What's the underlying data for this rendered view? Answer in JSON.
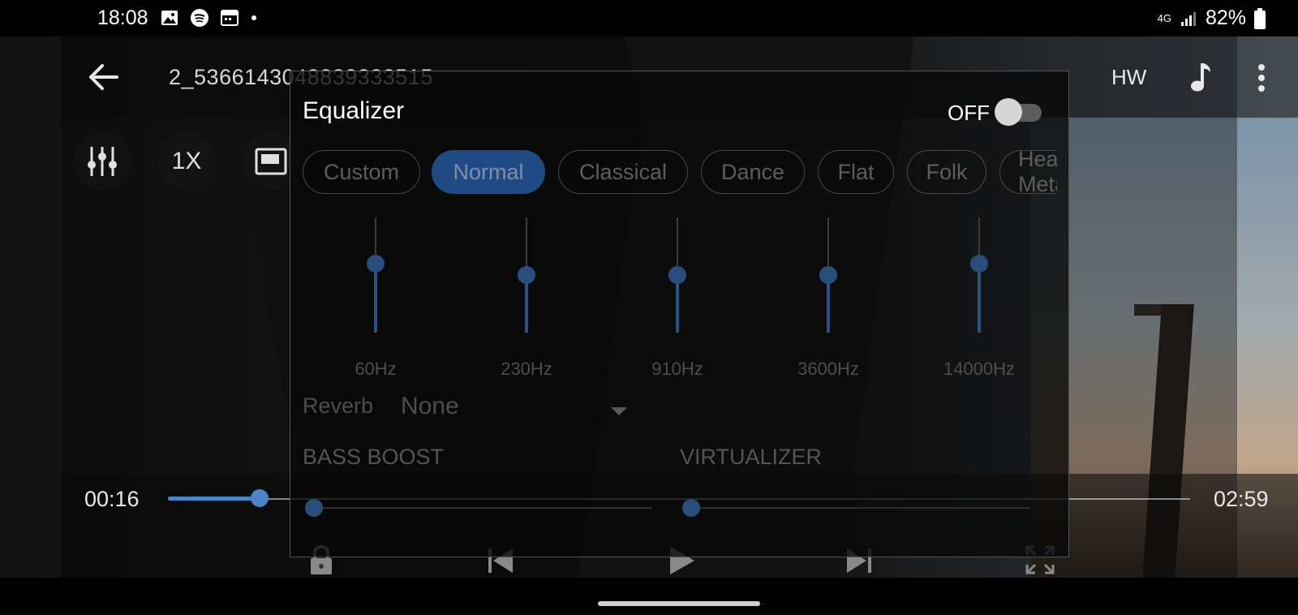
{
  "status_bar": {
    "time": "18:08",
    "network": "4G",
    "battery": "82%",
    "left_icons": [
      "gallery-icon",
      "spotify-icon",
      "calendar-icon",
      "dot-icon"
    ],
    "right_icons": [
      "signal-icon",
      "battery-icon"
    ]
  },
  "player": {
    "filename": "2_5366143048839333515",
    "hw_label": "HW",
    "speed_label": "1X",
    "current_time": "00:16",
    "total_time": "02:59",
    "progress": 0.09
  },
  "equalizer": {
    "title": "Equalizer",
    "toggle_label": "OFF",
    "enabled": false,
    "presets": [
      "Custom",
      "Normal",
      "Classical",
      "Dance",
      "Flat",
      "Folk",
      "Heavy Metal"
    ],
    "selected_preset": "Normal",
    "bands": [
      {
        "label": "60Hz",
        "level": 0.6
      },
      {
        "label": "230Hz",
        "level": 0.5
      },
      {
        "label": "910Hz",
        "level": 0.5
      },
      {
        "label": "3600Hz",
        "level": 0.5
      },
      {
        "label": "14000Hz",
        "level": 0.6
      }
    ],
    "reverb_label": "Reverb",
    "reverb_value": "None",
    "bass_boost_label": "BASS BOOST",
    "virtualizer_label": "VIRTUALIZER",
    "bass_boost_level": 0.0,
    "virtualizer_level": 0.0
  },
  "colors": {
    "accent": "#4a86c5",
    "selected_chip": "#1f4a83"
  }
}
